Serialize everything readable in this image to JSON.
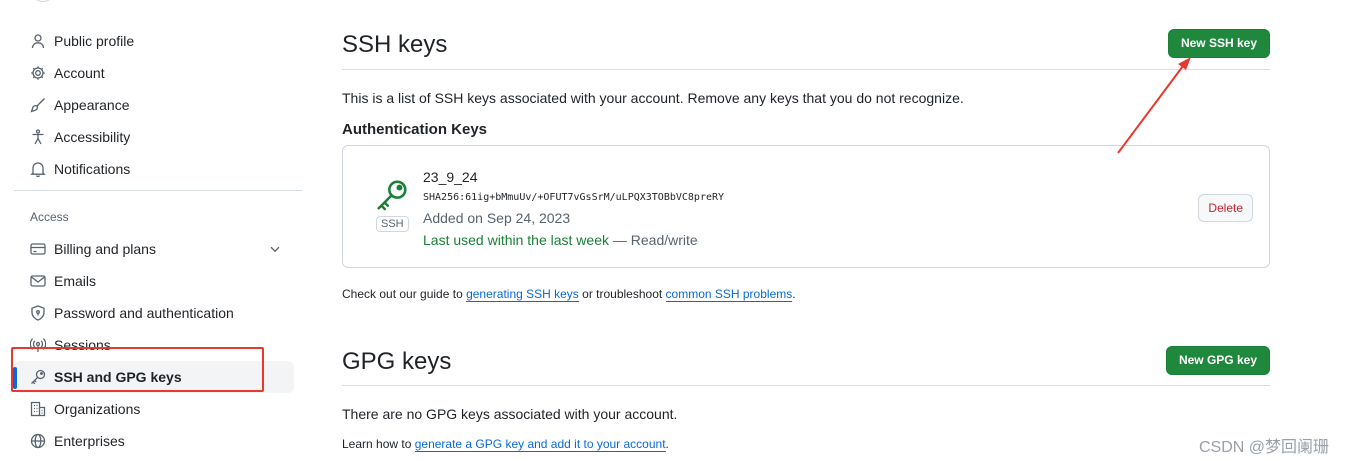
{
  "sidebar": {
    "items": [
      {
        "label": "Public profile",
        "icon": "person-icon"
      },
      {
        "label": "Account",
        "icon": "gear-icon"
      },
      {
        "label": "Appearance",
        "icon": "paintbrush-icon"
      },
      {
        "label": "Accessibility",
        "icon": "accessibility-icon"
      },
      {
        "label": "Notifications",
        "icon": "bell-icon"
      }
    ],
    "access_heading": "Access",
    "access_items": [
      {
        "label": "Billing and plans",
        "icon": "credit-card-icon"
      },
      {
        "label": "Emails",
        "icon": "mail-icon"
      },
      {
        "label": "Password and authentication",
        "icon": "shield-lock-icon"
      },
      {
        "label": "Sessions",
        "icon": "broadcast-icon"
      },
      {
        "label": "SSH and GPG keys",
        "icon": "key-icon",
        "active": true
      },
      {
        "label": "Organizations",
        "icon": "organization-icon"
      },
      {
        "label": "Enterprises",
        "icon": "globe-icon"
      }
    ]
  },
  "ssh": {
    "title": "SSH keys",
    "new_button": "New SSH key",
    "description": "This is a list of SSH keys associated with your account. Remove any keys that you do not recognize.",
    "auth_heading": "Authentication Keys",
    "key": {
      "type_label": "SSH",
      "title": "23_9_24",
      "fingerprint": "SHA256:61ig+bMmuUv/+OFUT7vGsSrM/uLPQX3TOBbVC8preRY",
      "added": "Added on Sep 24, 2023",
      "last_used": "Last used within the last week",
      "access": " — Read/write",
      "delete_label": "Delete"
    },
    "guide": {
      "prefix": "Check out our guide to ",
      "link1": "generating SSH keys",
      "middle": " or troubleshoot ",
      "link2": "common SSH problems",
      "suffix": "."
    }
  },
  "gpg": {
    "title": "GPG keys",
    "new_button": "New GPG key",
    "empty": "There are no GPG keys associated with your account.",
    "learn": {
      "prefix": "Learn how to ",
      "link": "generate a GPG key and add it to your account",
      "suffix": "."
    }
  },
  "annotations": {
    "highlight_color": "#e8392f",
    "arrow_color": "#e8392f"
  },
  "watermark": "CSDN @梦回阑珊",
  "colors": {
    "primary_green": "#1f883d",
    "link_blue": "#0969da",
    "danger_red": "#cf222e",
    "active_indicator": "#0969da"
  }
}
